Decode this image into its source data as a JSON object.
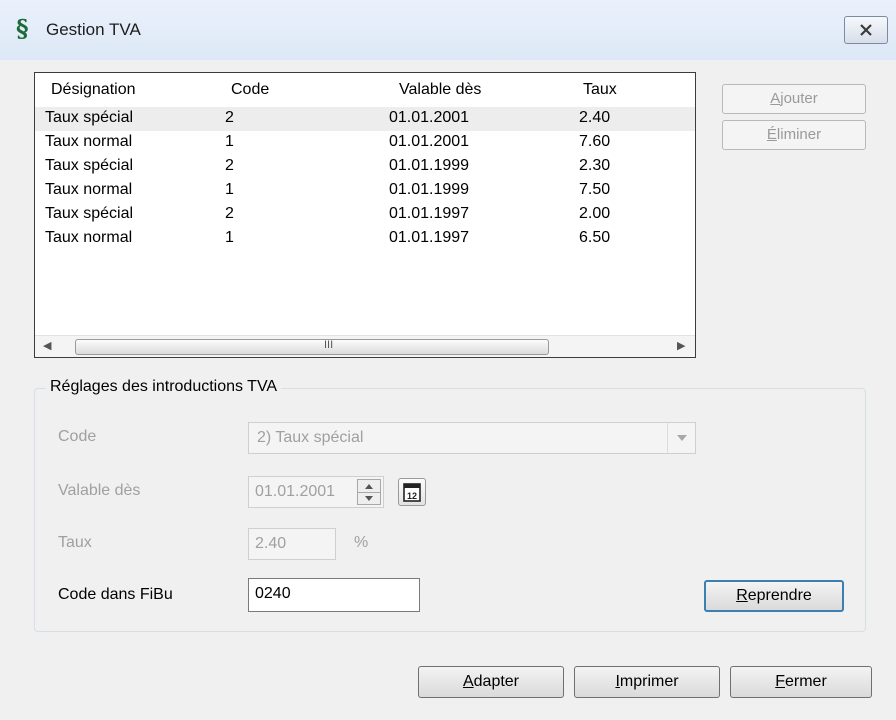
{
  "window": {
    "title": "Gestion TVA",
    "app_icon_glyph": "§",
    "close_label": "close"
  },
  "table": {
    "columns": [
      "Désignation",
      "Code",
      "Valable dès",
      "Taux"
    ],
    "rows": [
      [
        "Taux spécial",
        "2",
        "01.01.2001",
        "2.40"
      ],
      [
        "Taux normal",
        "1",
        "01.01.2001",
        "7.60"
      ],
      [
        "Taux spécial",
        "2",
        "01.01.1999",
        "2.30"
      ],
      [
        "Taux normal",
        "1",
        "01.01.1999",
        "7.50"
      ],
      [
        "Taux spécial",
        "2",
        "01.01.1997",
        "2.00"
      ],
      [
        "Taux normal",
        "1",
        "01.01.1997",
        "6.50"
      ]
    ],
    "selected_row": 0,
    "scroll_grip": "III"
  },
  "side_buttons": {
    "add": "Ajouter",
    "remove": "Éliminer"
  },
  "settings": {
    "group_title": "Réglages des introductions TVA",
    "code_label": "Code",
    "code_value": "2) Taux spécial",
    "valid_label": "Valable dès",
    "valid_value": "01.01.2001",
    "calendar_glyph": "12",
    "rate_label": "Taux",
    "rate_value": "2.40",
    "rate_unit": "%",
    "fibu_label": "Code dans FiBu",
    "fibu_value": "0240",
    "apply_button": "Reprendre"
  },
  "footer": {
    "adapt": "Adapter",
    "print": "Imprimer",
    "close": "Fermer"
  },
  "colors": {
    "title_bar": "#dde8f6",
    "default_button_border": "#3c7fb1",
    "disabled_text": "#a0a0a0"
  }
}
